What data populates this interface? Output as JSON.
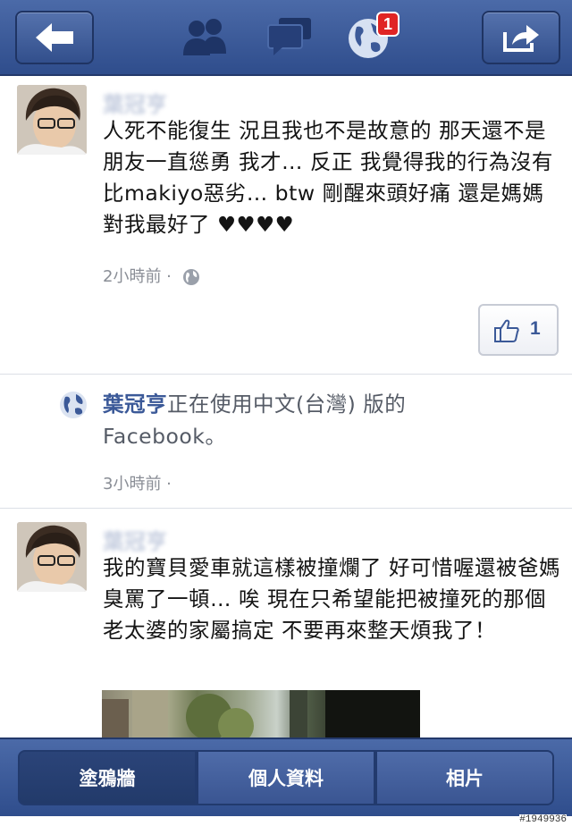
{
  "topbar": {
    "notification_count": "1",
    "icons": [
      "back-arrow-icon",
      "friends-icon",
      "messages-icon",
      "globe-notifications-icon",
      "share-icon"
    ]
  },
  "stories": [
    {
      "author": "葉冠亨",
      "text": "人死不能復生 況且我也不是故意的 那天還不是朋友一直慫勇 我才… 反正 我覺得我的行為沒有比makiyo惡劣… btw 剛醒來頭好痛 還是媽媽對我最好了 ♥♥♥♥",
      "time": "2小時前 ·",
      "like_count": "1"
    },
    {
      "name": "葉冠亨",
      "text": "正在使用中文(台灣) 版的Facebook。",
      "time": "3小時前 ·"
    },
    {
      "author": "葉冠亨",
      "text": "我的寶貝愛車就這樣被撞爛了 好可惜喔還被爸媽臭罵了一頓… 唉 現在只希望能把被撞死的那個老太婆的家屬搞定 不要再來整天煩我了！"
    }
  ],
  "tabs": {
    "wall": "塗鴉牆",
    "info": "個人資料",
    "photos": "相片"
  },
  "watermark": "#1949936",
  "colors": {
    "header": "#3b5998",
    "link": "#3b5998",
    "badge": "#e02424"
  }
}
